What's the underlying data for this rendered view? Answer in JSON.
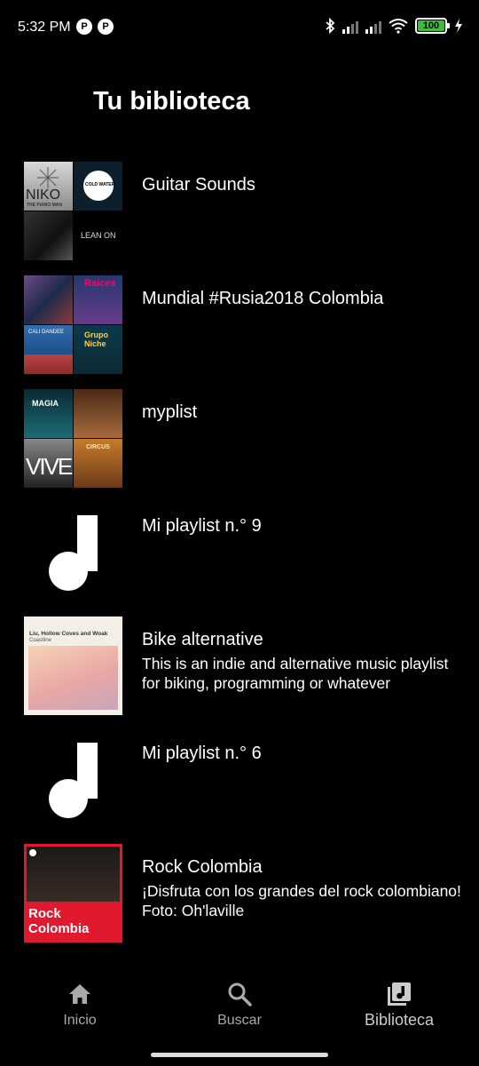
{
  "status": {
    "time": "5:32 PM",
    "battery": "100",
    "battery_level": 1.0
  },
  "page": {
    "title": "Tu biblioteca"
  },
  "library": {
    "items": [
      {
        "title": "Guitar Sounds",
        "description": "",
        "cover_texts": [
          "NIKO",
          "THE PIANO MAN",
          "COLD WATER",
          "LEAN ON"
        ]
      },
      {
        "title": "Mundial #Rusia2018 Colombia",
        "description": "",
        "cover_texts": [
          "Raíces",
          "CALI DANDEE",
          "Grupo Niche"
        ]
      },
      {
        "title": "myplist",
        "description": "",
        "cover_texts": [
          "MAGIA",
          "VIVES",
          "CIRCUS"
        ]
      },
      {
        "title": "Mi playlist n.° 9",
        "description": "",
        "cover_icon": "music-note-icon"
      },
      {
        "title": "Bike alternative",
        "description": "This is an indie and alternative music playlist for biking, programming or whatever",
        "cover_texts": [
          "Liu, Hollow Coves and Woak",
          "Coastline"
        ]
      },
      {
        "title": "Mi playlist n.° 6",
        "description": "",
        "cover_icon": "music-note-icon"
      },
      {
        "title": "Rock Colombia",
        "description": "¡Disfruta con los grandes del rock colombiano! Foto: Oh'laville",
        "cover_texts": [
          "Rock",
          "Colombia"
        ]
      }
    ]
  },
  "nav": {
    "items": [
      {
        "label": "Inicio",
        "icon": "home-icon"
      },
      {
        "label": "Buscar",
        "icon": "search-icon"
      },
      {
        "label": "Biblioteca",
        "icon": "library-icon",
        "active": true
      }
    ]
  },
  "colors": {
    "background": "#000000",
    "text": "#ffffff",
    "nav_inactive": "#aaaaaa",
    "rock_red": "#e0192e",
    "battery_green": "#3dbb3d"
  }
}
